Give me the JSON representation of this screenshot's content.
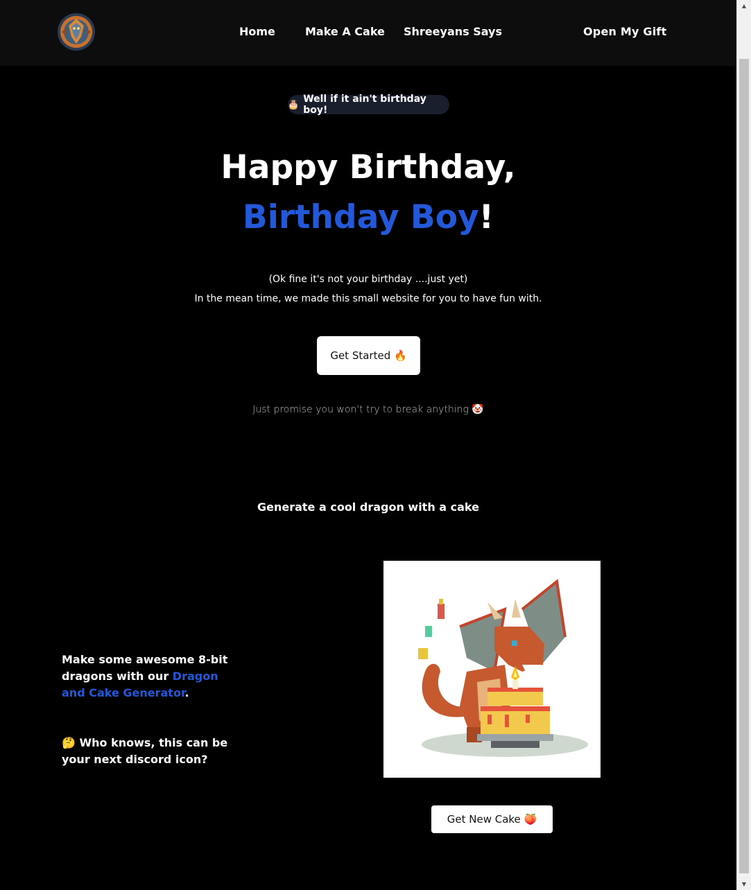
{
  "nav": {
    "logo_alt": "dragon-logo",
    "links": [
      {
        "label": "Home"
      },
      {
        "label": "Make A Cake"
      },
      {
        "label": "Shreeyans Says"
      }
    ],
    "gift_label": "Open My Gift"
  },
  "hero": {
    "pill_emoji": "🎂",
    "pill_text": "Well if it ain't birthday boy!",
    "title_line1": "Happy Birthday,",
    "title_highlight": "Birthday Boy",
    "title_suffix": "!",
    "subtitle1": "(Ok fine it's not your birthday ....just yet)",
    "subtitle2": "In the mean time, we made this small website for you to have fun with.",
    "cta_label": "Get Started 🔥",
    "promise": "Just promise you won't try to break anything 🤡"
  },
  "generator": {
    "heading": "Generate a cool dragon with a cake",
    "desc_prefix": "Make some awesome 8-bit dragons with our ",
    "desc_link": "Dragon and Cake Generator",
    "desc_suffix": ".",
    "discord_note": "🤔 Who knows, this can be your next discord icon?",
    "button_label": "Get New Cake 🍑"
  },
  "colors": {
    "accent": "#2359d9",
    "background": "#000000",
    "nav_background": "#0d0d0e"
  }
}
